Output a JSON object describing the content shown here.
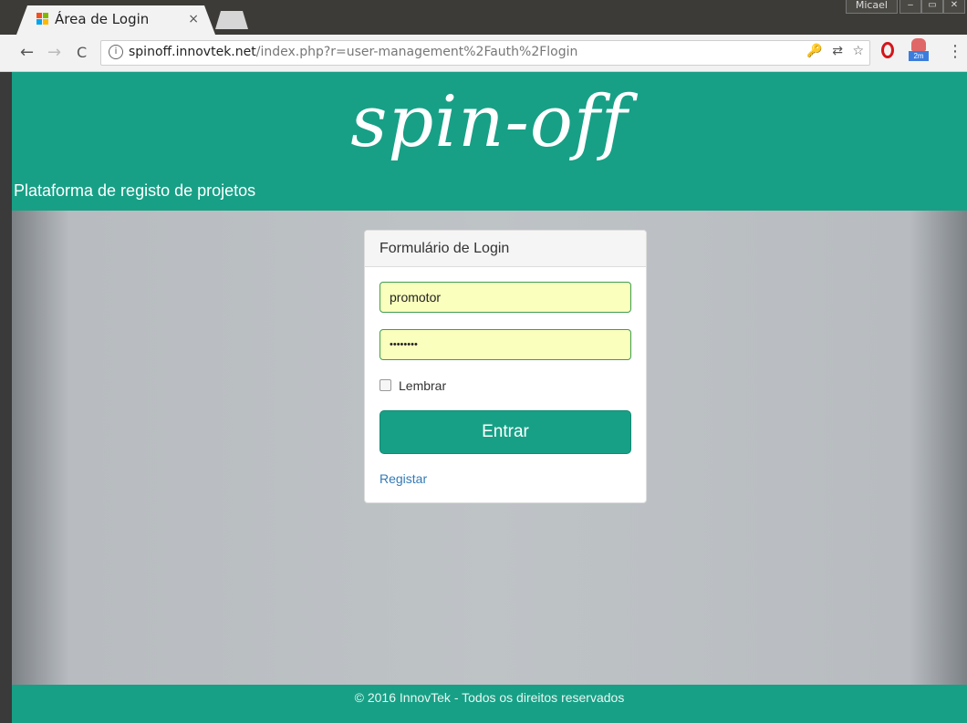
{
  "browser": {
    "tab_title": "Área de Login",
    "tab_close": "×",
    "window_user": "Micael",
    "window_controls": [
      "–",
      "▭",
      "✕"
    ],
    "url_host": "spinoff.innovtek.net",
    "url_path": "/index.php?r=user-management%2Fauth%2Flogin",
    "nav": {
      "back": "←",
      "forward": "→",
      "reload": "C"
    },
    "info_icon": "i",
    "omnibox_icons": [
      "key-icon",
      "translate-icon",
      "star-icon"
    ],
    "omnibox_glyphs": [
      "🔑",
      "⇄",
      "☆"
    ],
    "extension_badge": "2m",
    "menu": "⋮"
  },
  "header": {
    "logo": "spin-off",
    "subtitle": "Plataforma de registo de projetos"
  },
  "login": {
    "panel_title": "Formulário de Login",
    "username_value": "promotor",
    "password_value": "••••••••",
    "remember_label": "Lembrar",
    "remember_checked": false,
    "submit_label": "Entrar",
    "register_link": "Registar"
  },
  "footer": {
    "text": "© 2016 InnovTek - Todos os direitos reservados"
  },
  "colors": {
    "brand": "#17a086",
    "autofill": "#faffbd",
    "link": "#337ab7"
  }
}
